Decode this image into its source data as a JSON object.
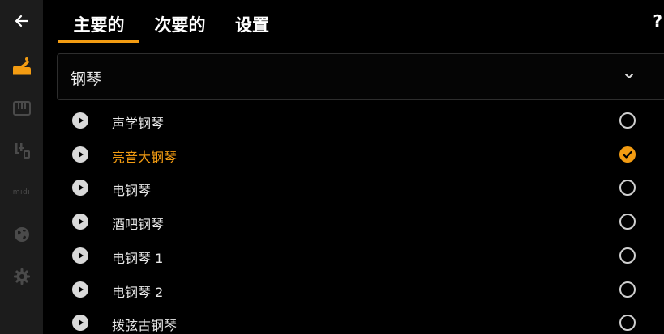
{
  "colors": {
    "accent": "#f39c12",
    "background": "#000000",
    "rail": "#1c1c1c",
    "icon_muted": "#4a4a4a"
  },
  "rail": {
    "items": [
      {
        "icon": "back-arrow-icon"
      },
      {
        "icon": "instrument-piano-icon",
        "active": true
      },
      {
        "icon": "keyboard-icon"
      },
      {
        "icon": "mixer-sliders-icon"
      },
      {
        "icon": "midi-icon",
        "text": "mıdı"
      },
      {
        "icon": "globe-icon"
      },
      {
        "icon": "gear-icon"
      }
    ]
  },
  "tabs": [
    {
      "label": "主要的",
      "active": true
    },
    {
      "label": "次要的",
      "active": false
    },
    {
      "label": "设置",
      "active": false
    }
  ],
  "help_label": "?",
  "dropdown": {
    "value": "钢琴",
    "icon": "chevron-down-icon"
  },
  "instruments": [
    {
      "label": "声学钢琴",
      "selected": false
    },
    {
      "label": "亮音大钢琴",
      "selected": true
    },
    {
      "label": "电钢琴",
      "selected": false
    },
    {
      "label": "酒吧钢琴",
      "selected": false
    },
    {
      "label": "电钢琴 1",
      "selected": false
    },
    {
      "label": "电钢琴 2",
      "selected": false
    },
    {
      "label": "拨弦古钢琴",
      "selected": false
    }
  ]
}
